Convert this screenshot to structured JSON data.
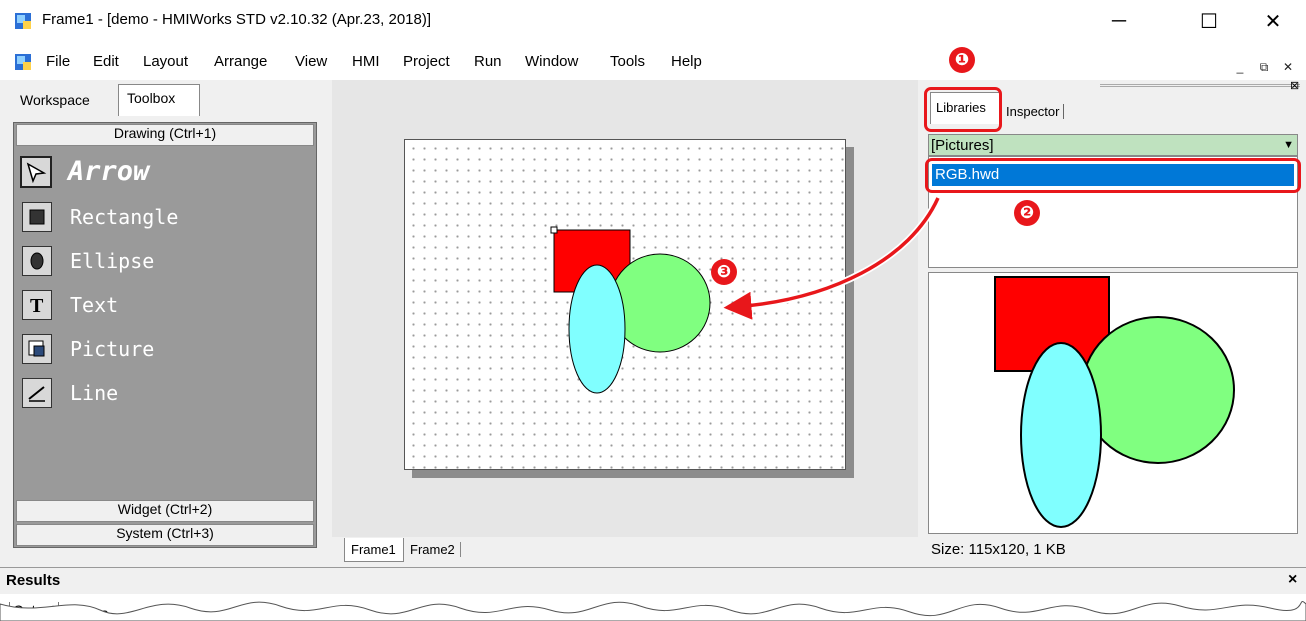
{
  "window": {
    "title": "Frame1 - [demo - HMIWorks STD v2.10.32 (Apr.23, 2018)]",
    "minimize_glyph": "─",
    "maximize_glyph": "☐",
    "close_glyph": "✕"
  },
  "menu": [
    "File",
    "Edit",
    "Layout",
    "Arrange",
    "View",
    "HMI",
    "Project",
    "Run",
    "Window",
    "Tools",
    "Help"
  ],
  "mdi": {
    "minimize": "_",
    "restore": "⧉",
    "close": "✕"
  },
  "left_tabs": {
    "workspace": "Workspace",
    "toolbox": "Toolbox"
  },
  "toolbox": {
    "drawing_header": "Drawing (Ctrl+1)",
    "widget_header": "Widget (Ctrl+2)",
    "system_header": "System (Ctrl+3)",
    "tools": [
      {
        "label": "Arrow",
        "icon": "arrow-icon"
      },
      {
        "label": "Rectangle",
        "icon": "rectangle-icon"
      },
      {
        "label": "Ellipse",
        "icon": "ellipse-icon"
      },
      {
        "label": "Text",
        "icon": "text-icon"
      },
      {
        "label": "Picture",
        "icon": "picture-icon"
      },
      {
        "label": "Line",
        "icon": "line-icon"
      }
    ]
  },
  "frame_tabs": [
    "Frame1",
    "Frame2"
  ],
  "right_tabs": {
    "libraries": "Libraries",
    "inspector": "Inspector"
  },
  "library": {
    "dropdown_value": "[Pictures]",
    "selected_file": "RGB.hwd",
    "preview_size": "Size: 115x120, 1 KB"
  },
  "results": {
    "title": "Results",
    "output_tab": "Output",
    "errors_tab": "Errors",
    "close_glyph": "×"
  },
  "callouts": [
    "❶",
    "❷",
    "❸"
  ],
  "colors": {
    "accent_red": "#e8171b",
    "shape_red": "#ff0000",
    "shape_green": "#80ff80",
    "shape_cyan": "#80ffff",
    "selection_blue": "#0078d7",
    "dropdown_green": "#bfe2bf"
  }
}
